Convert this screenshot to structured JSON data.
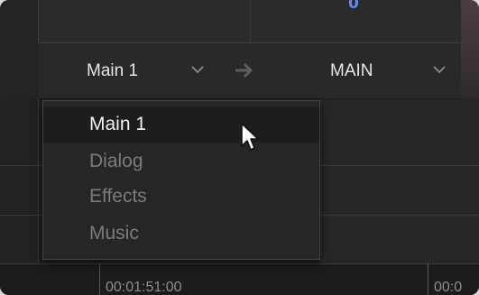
{
  "header": {
    "meter_value": "0"
  },
  "routing": {
    "source_label": "Main 1",
    "destination_label": "MAIN",
    "arrow_glyph": "→",
    "chevron_glyph": "⌵",
    "source_chevron_icon": "chevron-down-icon",
    "dest_chevron_icon": "chevron-down-icon"
  },
  "dropdown": {
    "items": [
      {
        "label": "Main 1",
        "selected": true
      },
      {
        "label": "Dialog",
        "selected": false
      },
      {
        "label": "Effects",
        "selected": false
      },
      {
        "label": "Music",
        "selected": false
      }
    ]
  },
  "timeline": {
    "timecode_1": "00:01:51:00",
    "timecode_2": "00:0"
  },
  "colors": {
    "accent_meter": "#5d8fe6",
    "text_primary": "#e6e6e6",
    "text_dim": "#7b7b7e"
  }
}
